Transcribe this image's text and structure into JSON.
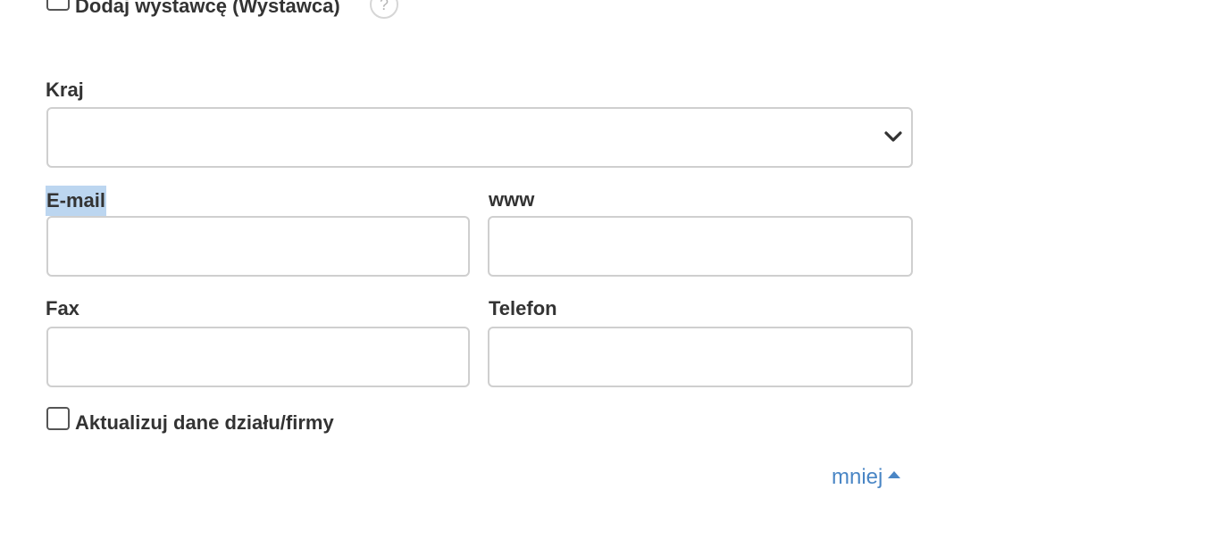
{
  "form": {
    "add_exhibitor_label": "Dodaj wystawcę (Wystawca)",
    "help_icon_text": "?",
    "country": {
      "label": "Kraj",
      "value": ""
    },
    "email": {
      "label": "E-mail",
      "value": ""
    },
    "www": {
      "label": "www",
      "value": ""
    },
    "fax": {
      "label": "Fax",
      "value": ""
    },
    "phone": {
      "label": "Telefon",
      "value": ""
    },
    "update_label": "Aktualizuj dane działu/firmy",
    "less_link": "mniej"
  },
  "colors": {
    "link": "#4a86c5",
    "selection_highlight": "#bcd6f0",
    "field_border": "#cfcfcf"
  },
  "icons": {
    "select_arrow": "chevron-down-icon",
    "less_arrow": "caret-up-icon",
    "help": "question-mark-icon"
  }
}
